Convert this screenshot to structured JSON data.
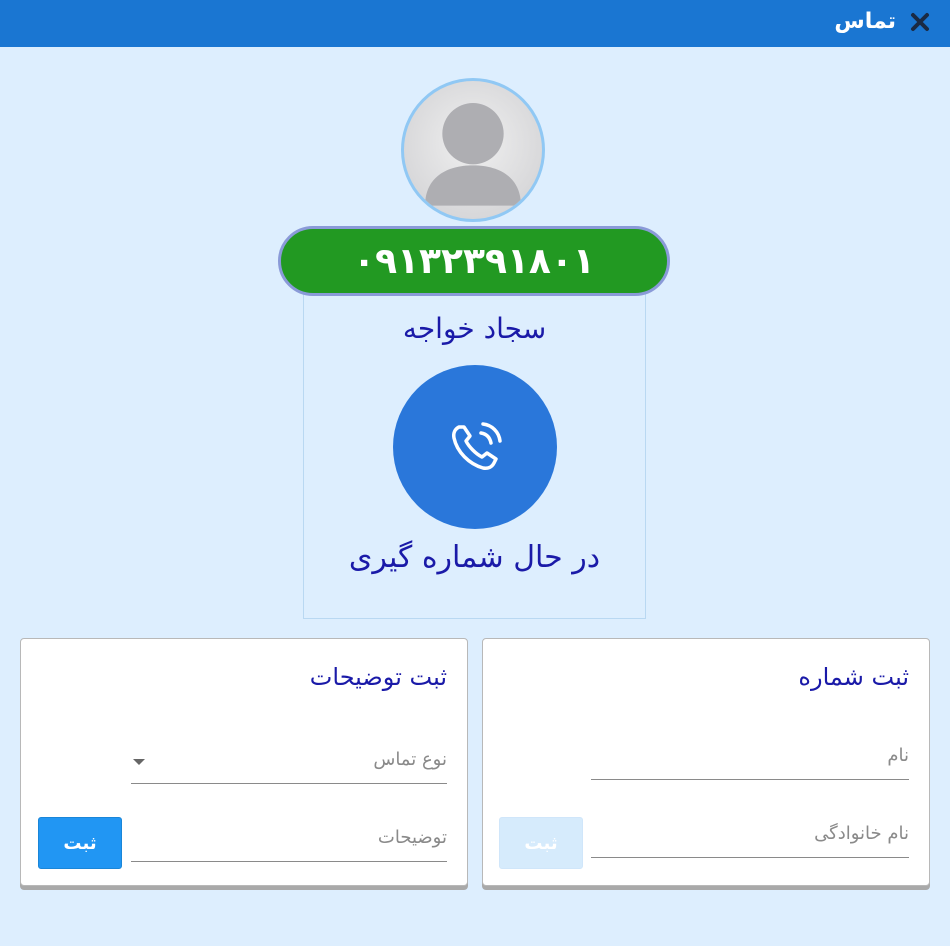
{
  "window": {
    "title": "تماس"
  },
  "contact": {
    "phone": "۰۹۱۳۲۳۹۱۸۰۱",
    "name": "سجاد خواجه",
    "status": "در حال شماره گیری"
  },
  "colors": {
    "titlebar": "#1a76d2",
    "background": "#ddeefe",
    "phone_pill": "#229922",
    "call_button": "#2a77da",
    "heading_text": "#1a1aa8",
    "primary_button": "#2196f3"
  },
  "notes_card": {
    "title": "ثبت توضیحات",
    "call_type_label": "نوع تماس",
    "description_label": "توضیحات",
    "submit_label": "ثبت"
  },
  "register_card": {
    "title": "ثبت شماره",
    "first_name_label": "نام",
    "last_name_label": "نام خانوادگی",
    "submit_label": "ثبت"
  }
}
